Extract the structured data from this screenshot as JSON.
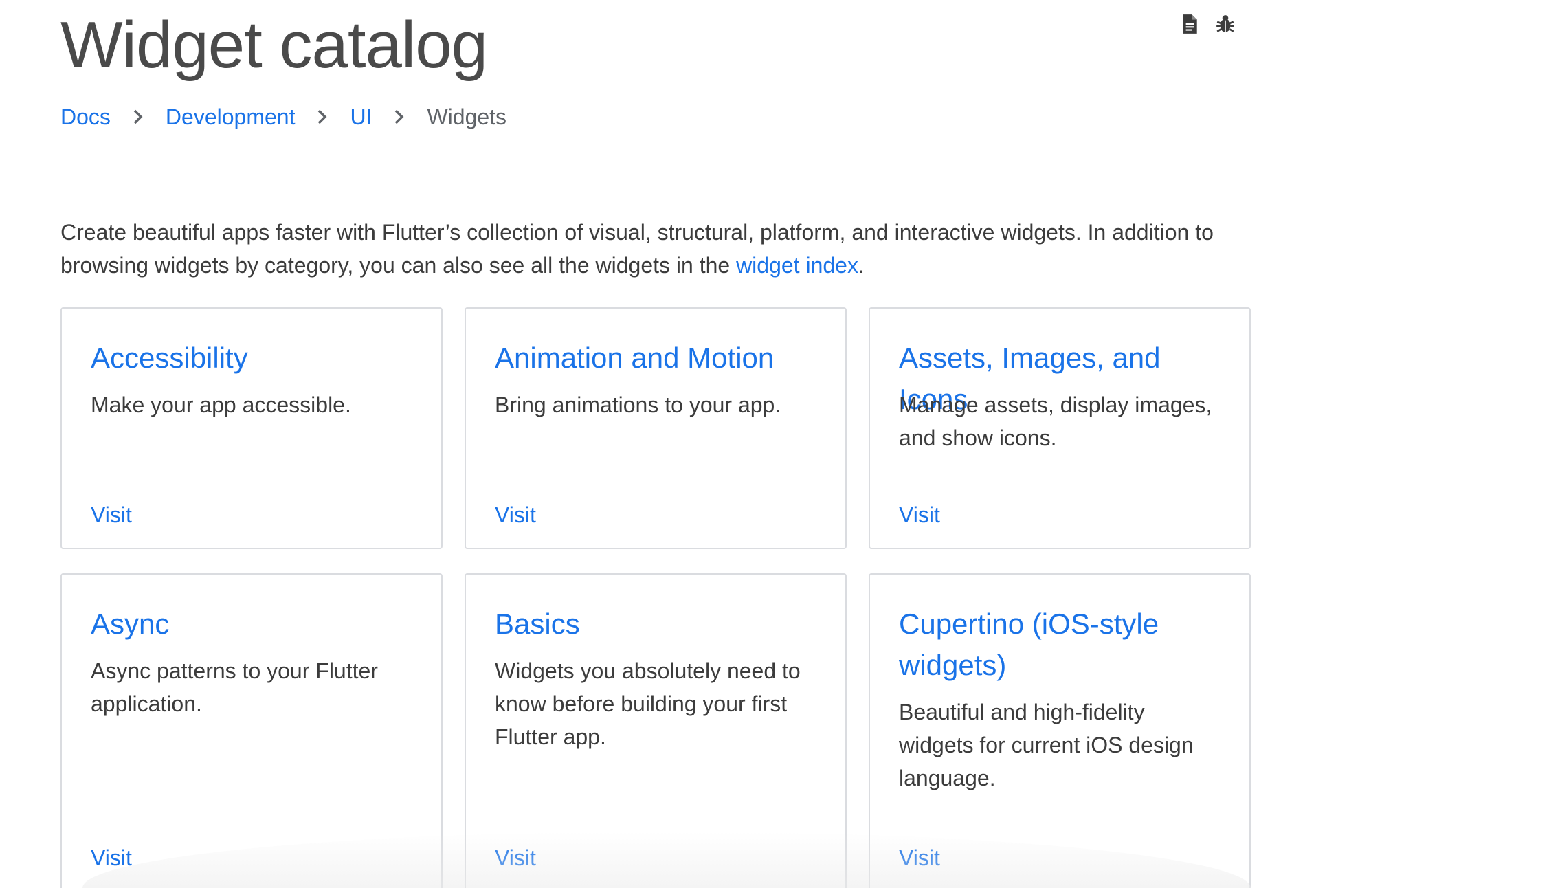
{
  "page": {
    "title": "Widget catalog",
    "actions": [
      {
        "name": "view-source-icon"
      },
      {
        "name": "report-issue-icon"
      }
    ]
  },
  "breadcrumb": {
    "items": [
      "Docs",
      "Development",
      "UI"
    ],
    "current": "Widgets"
  },
  "intro": {
    "text_before": "Create beautiful apps faster with Flutter’s collection of visual, structural, platform, and interactive widgets. In addition to browsing widgets by category, you can also see all the widgets in the ",
    "link_text": "widget index",
    "text_after": "."
  },
  "cards": [
    {
      "title": "Accessibility",
      "description": "Make your app accessible.",
      "link": "Visit"
    },
    {
      "title": "Animation and Motion",
      "description": "Bring animations to your app.",
      "link": "Visit"
    },
    {
      "title": "Assets, Images, and Icons",
      "description": "Manage assets, display images, and show icons.",
      "link": "Visit"
    },
    {
      "title": "Async",
      "description": "Async patterns to your Flutter application.",
      "link": "Visit"
    },
    {
      "title": "Basics",
      "description": "Widgets you absolutely need to know before building your first Flutter app.",
      "link": "Visit"
    },
    {
      "title": "Cupertino (iOS-style widgets)",
      "description": "Beautiful and high-fidelity widgets for current iOS design language.",
      "link": "Visit"
    }
  ],
  "colors": {
    "link": "#1a73e8",
    "text": "#3c3c3c",
    "border": "#dadce0"
  }
}
